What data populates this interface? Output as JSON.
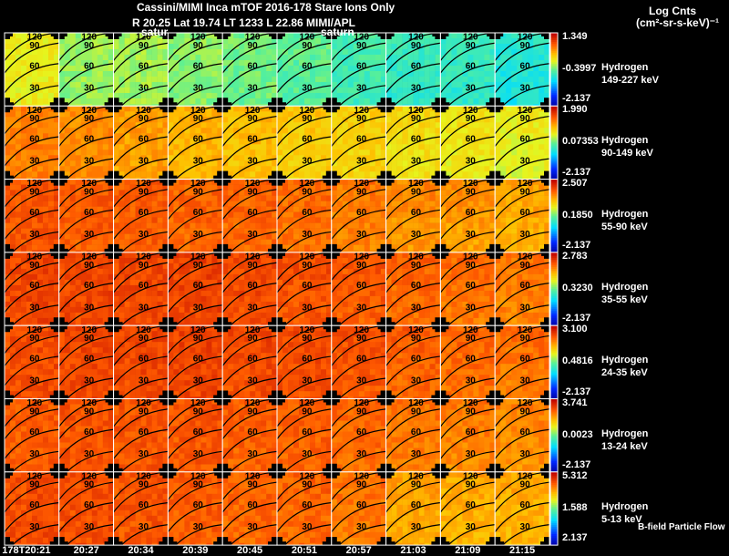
{
  "header": {
    "title": "Cassini/MIMI Inca mTOF  2016-178    Stare    Ions Only",
    "subtitle": "R         20.25 Lat 19.74 LT 1233 L          22.86  MIMI/APL",
    "overlay_labels": [
      "satur",
      "saturn"
    ]
  },
  "units": {
    "line1": "Log Cnts",
    "line2": "(cm²-sr-s-keV)⁻¹"
  },
  "footer_note": "B-field Particle Flow",
  "chart_data": {
    "type": "heatmap",
    "colormap": "jet",
    "contour_labels": [
      "120",
      "90",
      "60",
      "30"
    ],
    "times": [
      "178T20:21",
      "20:27",
      "20:34",
      "20:39",
      "20:45",
      "20:51",
      "20:57",
      "21:03",
      "21:09",
      "21:15"
    ],
    "rows": [
      {
        "species": "Hydrogen",
        "energy": "149-227 keV",
        "max": "1.349",
        "mid": "-0.3997",
        "min": "-2.137",
        "levels": [
          0.63,
          0.55,
          0.56,
          0.54,
          0.52,
          0.5,
          0.47,
          0.45,
          0.45,
          0.42
        ]
      },
      {
        "species": "Hydrogen",
        "energy": "90-149 keV",
        "max": "1.990",
        "mid": "0.07353",
        "min": "-2.137",
        "levels": [
          0.8,
          0.78,
          0.76,
          0.73,
          0.72,
          0.7,
          0.69,
          0.67,
          0.66,
          0.64
        ]
      },
      {
        "species": "Hydrogen",
        "energy": "55-90 keV",
        "max": "2.507",
        "mid": "0.1850",
        "min": "-2.137",
        "levels": [
          0.86,
          0.85,
          0.85,
          0.84,
          0.84,
          0.83,
          0.81,
          0.79,
          0.78,
          0.76
        ]
      },
      {
        "species": "Hydrogen",
        "energy": "35-55 keV",
        "max": "2.783",
        "mid": "0.3230",
        "min": "-2.137",
        "levels": [
          0.88,
          0.88,
          0.88,
          0.89,
          0.88,
          0.87,
          0.86,
          0.84,
          0.83,
          0.82
        ]
      },
      {
        "species": "Hydrogen",
        "energy": "24-35 keV",
        "max": "3.100",
        "mid": "0.4816",
        "min": "-2.137",
        "levels": [
          0.87,
          0.88,
          0.88,
          0.89,
          0.88,
          0.88,
          0.87,
          0.85,
          0.84,
          0.83
        ]
      },
      {
        "species": "Hydrogen",
        "energy": "13-24 keV",
        "max": "3.741",
        "mid": "0.0023",
        "min": "-2.137",
        "levels": [
          0.85,
          0.86,
          0.86,
          0.86,
          0.85,
          0.85,
          0.84,
          0.82,
          0.81,
          0.8
        ]
      },
      {
        "species": "Hydrogen",
        "energy": "5-13 keV",
        "max": "5.312",
        "mid": "1.588",
        "min": "2.137",
        "levels": [
          0.87,
          0.87,
          0.86,
          0.85,
          0.84,
          0.84,
          0.82,
          0.76,
          0.75,
          0.75
        ]
      }
    ]
  }
}
